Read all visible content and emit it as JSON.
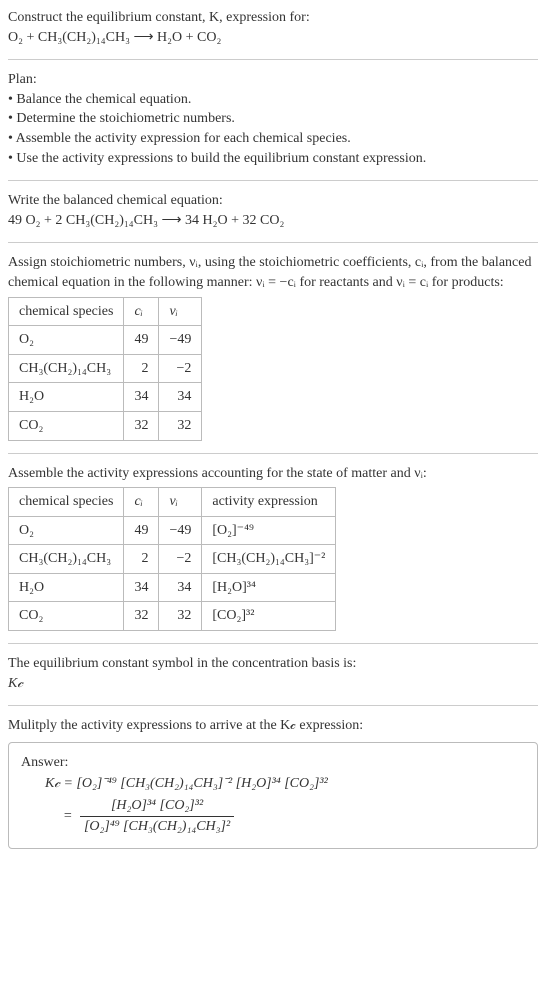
{
  "header": {
    "title_line1": "Construct the equilibrium constant, K, expression for:",
    "eq1": "O₂ + CH₃(CH₂)₁₄CH₃  ⟶  H₂O + CO₂"
  },
  "plan": {
    "heading": "Plan:",
    "b1": "• Balance the chemical equation.",
    "b2": "• Determine the stoichiometric numbers.",
    "b3": "• Assemble the activity expression for each chemical species.",
    "b4": "• Use the activity expressions to build the equilibrium constant expression."
  },
  "balanced": {
    "heading": "Write the balanced chemical equation:",
    "eq": "49 O₂ + 2 CH₃(CH₂)₁₄CH₃  ⟶  34 H₂O + 32 CO₂"
  },
  "stoich": {
    "intro1": "Assign stoichiometric numbers, νᵢ, using the stoichiometric coefficients, cᵢ, from the balanced chemical equation in the following manner: νᵢ = −cᵢ for reactants and νᵢ = cᵢ for products:",
    "h1": "chemical species",
    "h2": "cᵢ",
    "h3": "νᵢ",
    "r1c1": "O₂",
    "r1c2": "49",
    "r1c3": "−49",
    "r2c1": "CH₃(CH₂)₁₄CH₃",
    "r2c2": "2",
    "r2c3": "−2",
    "r3c1": "H₂O",
    "r3c2": "34",
    "r3c3": "34",
    "r4c1": "CO₂",
    "r4c2": "32",
    "r4c3": "32"
  },
  "activity": {
    "intro": "Assemble the activity expressions accounting for the state of matter and νᵢ:",
    "h1": "chemical species",
    "h2": "cᵢ",
    "h3": "νᵢ",
    "h4": "activity expression",
    "r1c1": "O₂",
    "r1c2": "49",
    "r1c3": "−49",
    "r1c4": "[O₂]⁻⁴⁹",
    "r2c1": "CH₃(CH₂)₁₄CH₃",
    "r2c2": "2",
    "r2c3": "−2",
    "r2c4": "[CH₃(CH₂)₁₄CH₃]⁻²",
    "r3c1": "H₂O",
    "r3c2": "34",
    "r3c3": "34",
    "r3c4": "[H₂O]³⁴",
    "r4c1": "CO₂",
    "r4c2": "32",
    "r4c3": "32",
    "r4c4": "[CO₂]³²"
  },
  "kc_symbol": {
    "line1": "The equilibrium constant symbol in the concentration basis is:",
    "line2": "K𝒸"
  },
  "multiply": {
    "line": "Mulitply the activity expressions to arrive at the K𝒸 expression:"
  },
  "answer": {
    "heading": "Answer:",
    "line1": "K𝒸 = [O₂]⁻⁴⁹ [CH₃(CH₂)₁₄CH₃]⁻² [H₂O]³⁴ [CO₂]³²",
    "eq_prefix": "= ",
    "frac_num": "[H₂O]³⁴ [CO₂]³²",
    "frac_den": "[O₂]⁴⁹ [CH₃(CH₂)₁₄CH₃]²"
  }
}
